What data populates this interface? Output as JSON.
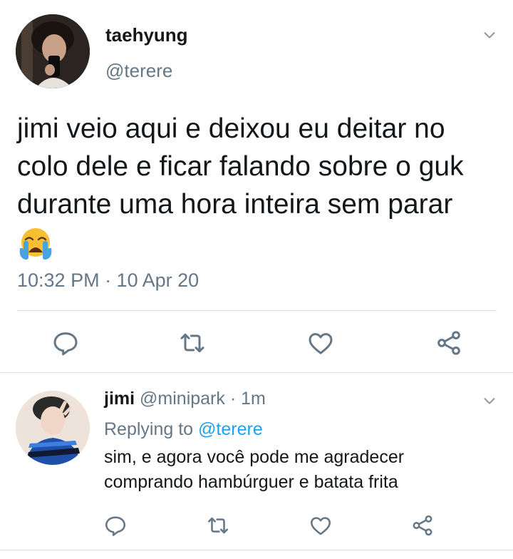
{
  "main_tweet": {
    "display_name": "taehyung",
    "handle": "@terere",
    "text": "jimi veio aqui e deixou eu deitar no colo dele e ficar falando sobre o guk durante uma hora inteira sem parar",
    "emoji": "loudly-crying-face",
    "timestamp": "10:32 PM · 10 Apr 20",
    "actions": [
      "reply-icon",
      "retweet-icon",
      "like-icon",
      "share-icon"
    ]
  },
  "reply_tweet": {
    "display_name": "jimi",
    "handle": "@minipark",
    "time": " · 1m",
    "replying_prefix": "Replying to ",
    "replying_to": "@terere",
    "text": "sim, e agora você pode me agradecer comprando hambúrguer e batata frita",
    "actions": [
      "reply-icon",
      "retweet-icon",
      "like-icon",
      "share-icon"
    ]
  },
  "colors": {
    "text_primary": "#14171a",
    "text_secondary": "#657786",
    "link": "#1da1f2",
    "divider": "#dbe3ea"
  }
}
